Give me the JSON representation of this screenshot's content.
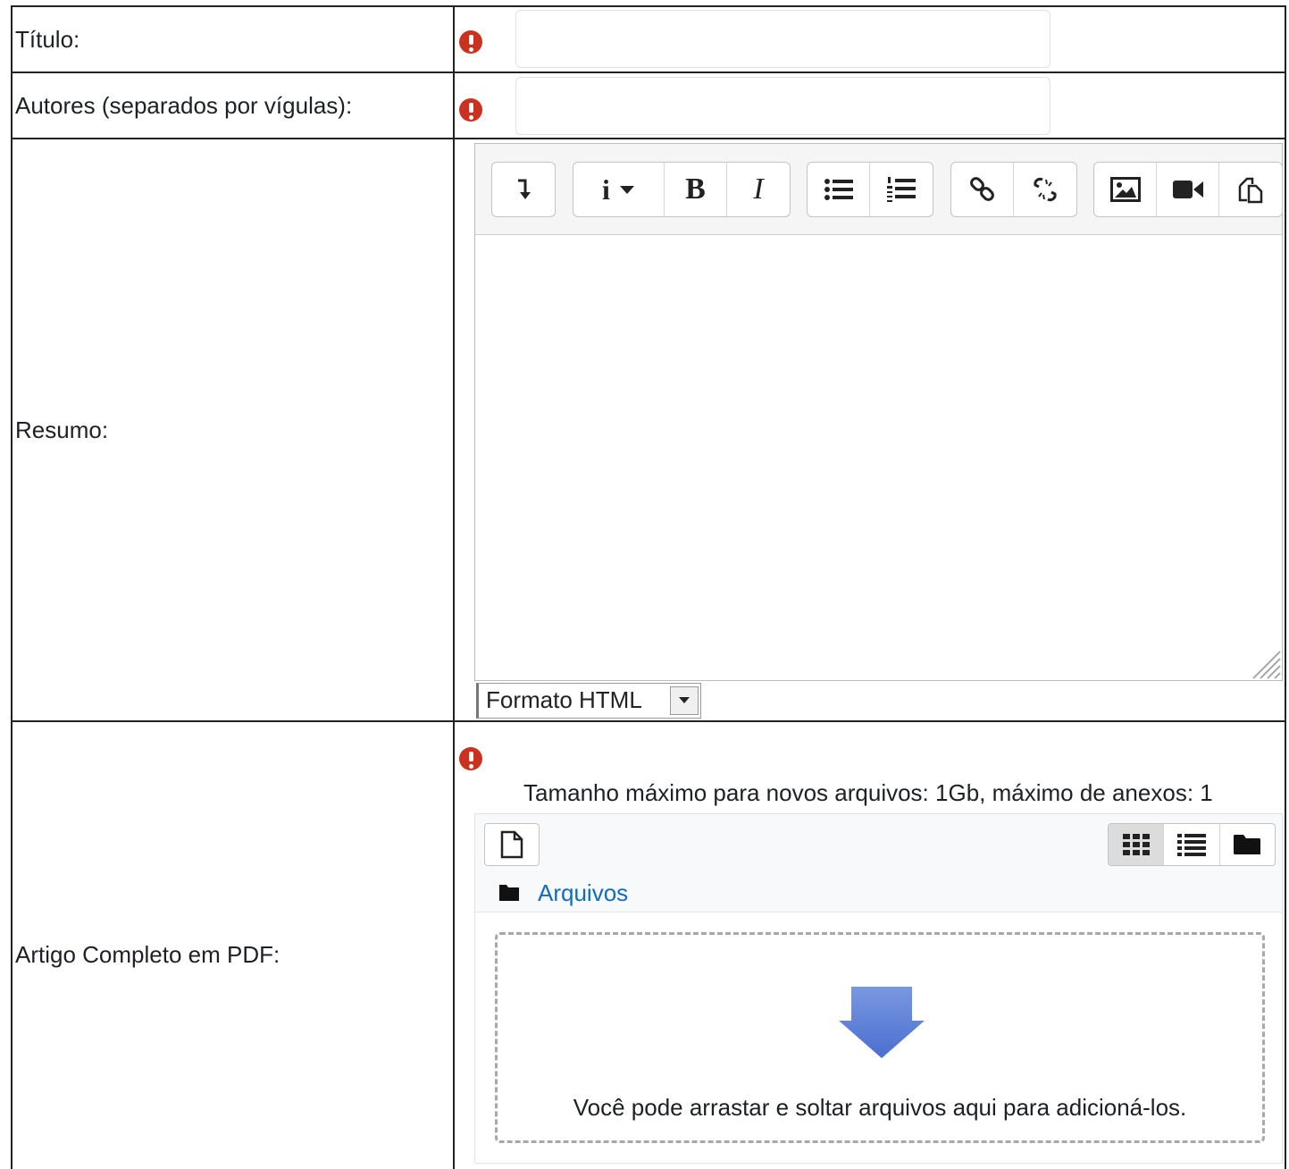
{
  "fields": {
    "titulo": {
      "label": "Título:",
      "value": ""
    },
    "autores": {
      "label": "Autores (separados por vígulas):",
      "value": ""
    },
    "resumo": {
      "label": "Resumo:"
    },
    "artigo": {
      "label": "Artigo Completo em PDF:"
    }
  },
  "editor": {
    "toolbar_icons": [
      "collapse-icon",
      "info-style-icon",
      "bold-icon",
      "italic-icon",
      "unordered-list-icon",
      "ordered-list-icon",
      "link-icon",
      "unlink-icon",
      "image-icon",
      "media-icon",
      "manage-files-icon"
    ],
    "bold_glyph": "B",
    "italic_glyph": "I",
    "style_glyph": "i",
    "format_select": "Formato HTML"
  },
  "filemanager": {
    "max_size_text": "Tamanho máximo para novos arquivos: 1Gb, máximo de anexos: 1",
    "folder_link": "Arquivos",
    "drop_message": "Você pode arrastar e soltar arquivos aqui para adicioná-los."
  },
  "colors": {
    "required_icon": "#ca3120",
    "link": "#0f6cbf",
    "drop_arrow": "#5b7fd6"
  }
}
